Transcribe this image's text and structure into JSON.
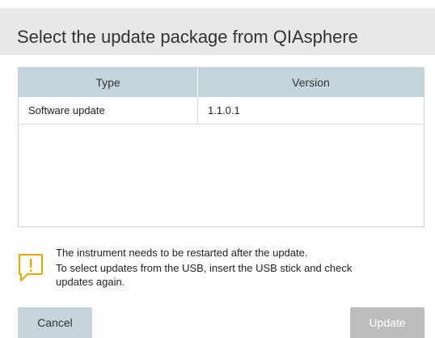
{
  "dialog": {
    "title": "Select the update package from QIAsphere"
  },
  "table": {
    "columns": [
      "Type",
      "Version"
    ],
    "rows": [
      {
        "type": "Software update",
        "version": "1.1.0.1"
      }
    ]
  },
  "notice": {
    "icon": "warning-icon",
    "line1": "The instrument needs to be restarted after the update.",
    "line2": "To select updates from the USB, insert the USB stick and check",
    "line3": "updates again."
  },
  "buttons": {
    "cancel_label": "Cancel",
    "update_label": "Update"
  },
  "colors": {
    "header_bg": "#e8e8e8",
    "table_header_bg": "#c4d4dc",
    "warning_accent": "#e0a800",
    "cancel_bg": "#c6d4dc",
    "update_disabled_bg": "#bdbdbd"
  }
}
